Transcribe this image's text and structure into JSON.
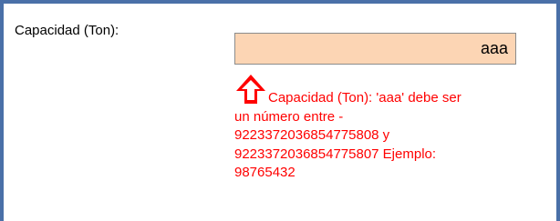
{
  "field": {
    "label": "Capacidad (Ton):",
    "value": "aaa"
  },
  "error": {
    "icon": "up-arrow-error-icon",
    "lines": [
      "Capacidad (Ton): 'aaa' debe ser",
      "un número entre -",
      "9223372036854775808 y",
      "9223372036854775807 Ejemplo:",
      "98765432"
    ]
  },
  "colors": {
    "frame_border": "#4a70a8",
    "input_background": "#fcd5b4",
    "error_text": "#ff0000"
  }
}
